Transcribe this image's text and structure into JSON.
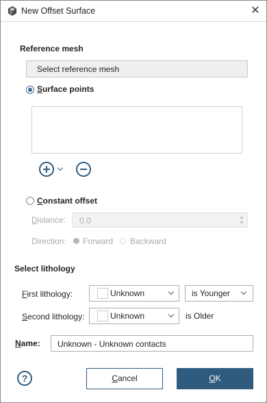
{
  "window": {
    "title": "New Offset Surface",
    "close_glyph": "✕"
  },
  "reference_mesh": {
    "heading": "Reference mesh",
    "button_label": "Select reference mesh"
  },
  "surface_points": {
    "label_first": "S",
    "label_rest": "urface points",
    "selected": true
  },
  "constant_offset": {
    "label_first": "C",
    "label_rest": "onstant offset",
    "selected": false,
    "distance_label_first": "D",
    "distance_label_rest": "istance:",
    "distance_value": "0.0",
    "direction_label": "Direction:",
    "forward_label": "Forward",
    "backward_label": "Backward"
  },
  "lithology": {
    "heading": "Select lithology",
    "first_label_first": "F",
    "first_label_rest": "irst lithology:",
    "first_value": "Unknown",
    "relation_value": "is Younger",
    "second_label_first": "S",
    "second_label_rest": "econd lithology:",
    "second_value": "Unknown",
    "second_relation": "is Older"
  },
  "name": {
    "label_first": "N",
    "label_rest": "ame:",
    "value": "Unknown - Unknown contacts"
  },
  "footer": {
    "help_glyph": "?",
    "cancel_first": "C",
    "cancel_rest": "ancel",
    "ok_first": "O",
    "ok_rest": "K"
  },
  "colors": {
    "accent": "#2e5b7e",
    "radio_accent": "#3c6d95",
    "disabled_text": "#a8a8a8"
  },
  "icons": [
    "app-icon",
    "close-icon",
    "add-icon",
    "chevron-down-icon",
    "remove-icon",
    "help-icon"
  ]
}
